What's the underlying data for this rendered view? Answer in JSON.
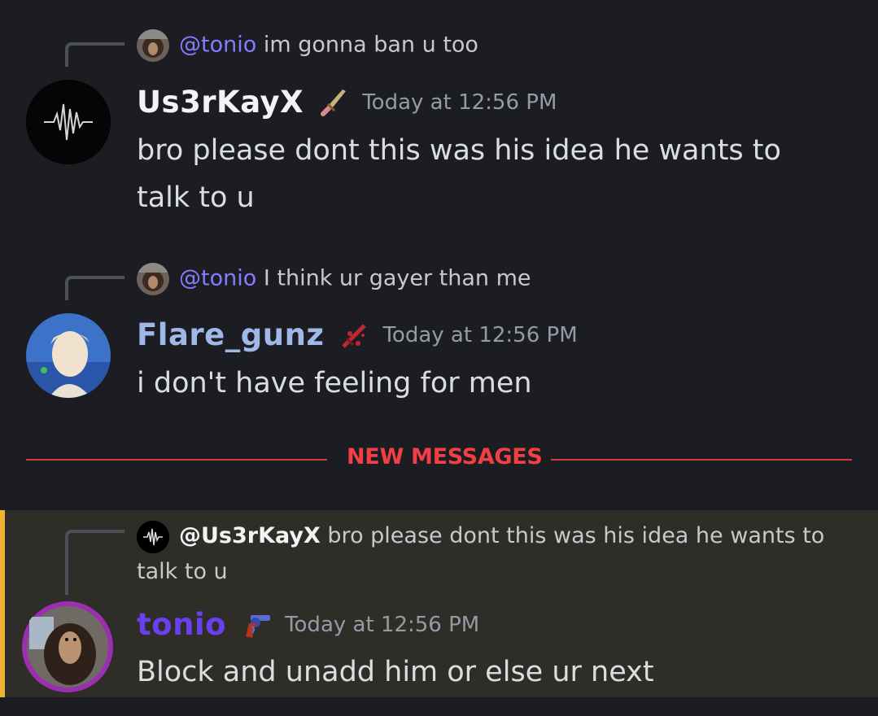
{
  "messages": [
    {
      "reply": {
        "mention": "@tonio",
        "text": "im gonna ban u too"
      },
      "author": "Us3rKayX",
      "author_color": "#f2f3f5",
      "timestamp": "Today at 12:56 PM",
      "text": "bro please dont this was his idea he wants to talk to u",
      "badge_icon": "knife-icon"
    },
    {
      "reply": {
        "mention": "@tonio",
        "text": "I think ur gayer than me"
      },
      "author": "Flare_gunz",
      "author_color": "#9fb8e8",
      "timestamp": "Today at 12:56 PM",
      "text": "i don't have feeling for men",
      "badge_icon": "bloody-sword-icon"
    },
    {
      "reply": {
        "mention": "@Us3rKayX",
        "text": "bro please dont this was his idea he wants to talk to u"
      },
      "author": "tonio",
      "author_color": "#6b3ff0",
      "timestamp": "Today at 12:56 PM",
      "text": "Block and unadd him or else ur next",
      "badge_icon": "revolver-icon",
      "highlighted": true
    }
  ],
  "divider": {
    "label": "NEW MESSAGES",
    "color": "#f23f43"
  },
  "colors": {
    "background": "#1c1d22",
    "mention": "#8a79ff",
    "highlight_bar": "#f0b232"
  }
}
